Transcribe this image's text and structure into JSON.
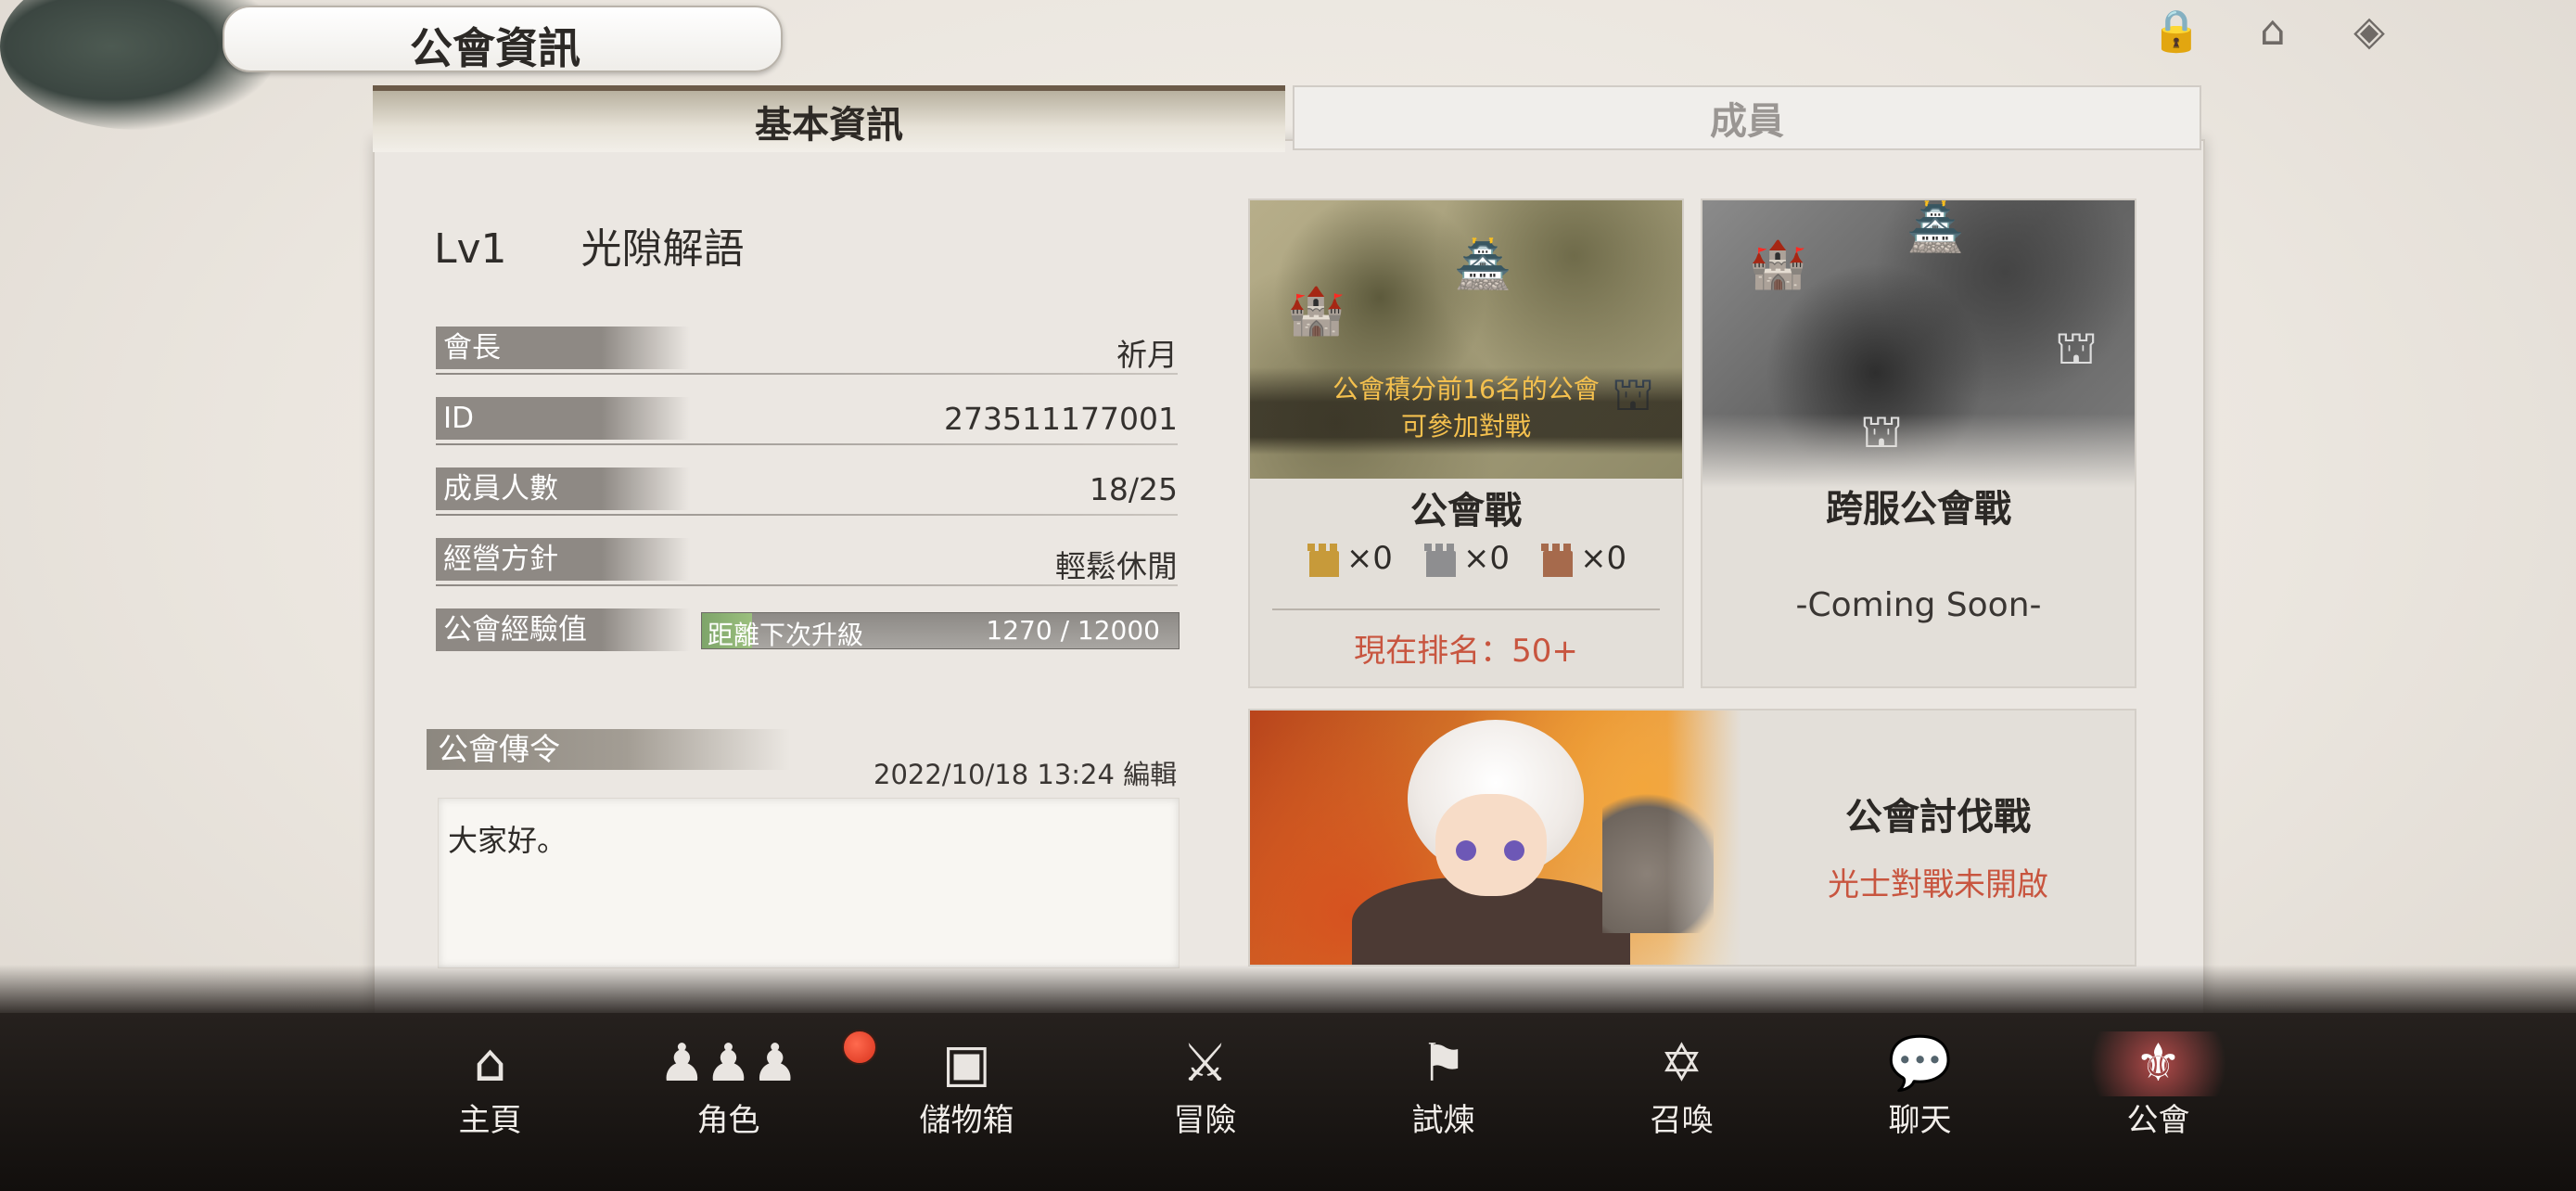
{
  "header": {
    "title": "公會資訊"
  },
  "top_icons": [
    "lock-icon",
    "shop-icon",
    "help-icon"
  ],
  "tabs": [
    {
      "label": "基本資訊",
      "active": true
    },
    {
      "label": "成員",
      "active": false
    }
  ],
  "guild": {
    "level": "Lv1",
    "name": "光隙解語",
    "rows": {
      "leader": {
        "label": "會長",
        "value": "祈月"
      },
      "id": {
        "label": "ID",
        "value": "273511177001"
      },
      "members": {
        "label": "成員人數",
        "value": "18/25"
      },
      "policy": {
        "label": "經營方針",
        "value": "輕鬆休閒"
      },
      "exp": {
        "label": "公會經驗值",
        "bar_text": "距離下次升級",
        "value": "1270 / 12000",
        "progress": 0.106
      }
    }
  },
  "notice": {
    "label": "公會傳令",
    "meta": "2022/10/18 13:24 編輯",
    "text": "大家好。"
  },
  "guild_war": {
    "notice": "公會積分前16名的公會\n可參加對戰",
    "title": "公會戰",
    "tokens": [
      {
        "icon": "gold-tower-icon",
        "count": "×0",
        "color": "#c79a3a"
      },
      {
        "icon": "silver-tower-icon",
        "count": "×0",
        "color": "#8e8e90"
      },
      {
        "icon": "bronze-tower-icon",
        "count": "×0",
        "color": "#a66a4c"
      }
    ],
    "rank": "現在排名：50+"
  },
  "cross_war": {
    "title": "跨服公會戰",
    "status": "-Coming Soon-"
  },
  "subdue": {
    "title": "公會討伐戰",
    "status": "光士對戰未開啟"
  },
  "nav": [
    {
      "label": "主頁",
      "icon": "home-icon"
    },
    {
      "label": "角色",
      "icon": "characters-icon"
    },
    {
      "label": "儲物箱",
      "icon": "chest-icon"
    },
    {
      "label": "冒險",
      "icon": "crossed-swords-icon"
    },
    {
      "label": "試煉",
      "icon": "flag-icon"
    },
    {
      "label": "召喚",
      "icon": "summon-icon"
    },
    {
      "label": "聊天",
      "icon": "chat-icon"
    },
    {
      "label": "公會",
      "icon": "guild-icon"
    }
  ],
  "colors": {
    "accent_red": "#c8553f",
    "gold_text": "#f4c04e"
  }
}
